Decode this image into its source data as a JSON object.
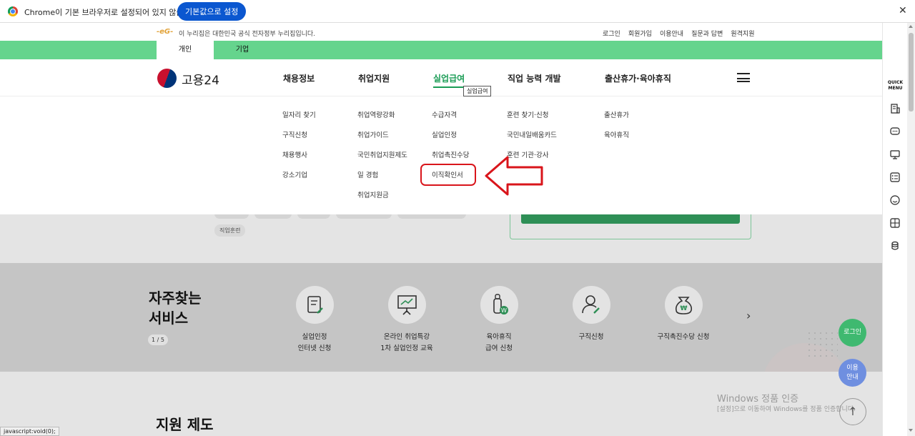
{
  "infobar": {
    "message": "Chrome이 기본 브라우저로 설정되어 있지 않습니다",
    "button_label": "기본값으로 설정",
    "close_glyph": "✕"
  },
  "topbar": {
    "gov_mark": "-eG-",
    "gov_notice": "이 누리집은 대한민국 공식 전자정부 누리집입니다.",
    "links": [
      "로그인",
      "회원가입",
      "이용안내",
      "질문과 답변",
      "원격지원"
    ]
  },
  "tabs": {
    "personal": "개인",
    "company": "기업"
  },
  "logo": {
    "text": "고용24"
  },
  "nav": {
    "items": [
      "채용정보",
      "취업지원",
      "실업급여",
      "직업 능력 개발",
      "출산휴가·육아휴직"
    ],
    "active": "실업급여",
    "tooltip": "실업급여"
  },
  "megamenu": {
    "col1": [
      "일자리 찾기",
      "구직신청",
      "채용행사",
      "강소기업"
    ],
    "col2": [
      "취업역량강화",
      "취업가이드",
      "국민취업지원제도",
      "일 경험",
      "취업지원금"
    ],
    "col3": [
      "수급자격",
      "실업인정",
      "취업촉진수당",
      "이직확인서"
    ],
    "col4": [
      "훈련 찾기·신청",
      "국민내일배움카드",
      "훈련 기관·강사"
    ],
    "col5": [
      "출산휴가",
      "육아휴직"
    ]
  },
  "search": {
    "tag": "직업훈련"
  },
  "services": {
    "title_line1": "자주찾는",
    "title_line2": "서비스",
    "pager": "1 / 5",
    "items": [
      {
        "line1": "실업인정",
        "line2": "인터넷 신청",
        "icon": "document-pen-icon"
      },
      {
        "line1": "온라인 취업특강",
        "line2": "1차 실업인정 교육",
        "icon": "presentation-board-icon"
      },
      {
        "line1": "육아휴직",
        "line2": "급여 신청",
        "icon": "baby-bottle-won-icon"
      },
      {
        "line1": "구직신청",
        "line2": "",
        "icon": "person-pen-icon"
      },
      {
        "line1": "구직촉진수당 신청",
        "line2": "",
        "icon": "money-bag-won-icon"
      }
    ],
    "next_glyph": "›"
  },
  "support": {
    "title": "지원 제도"
  },
  "quickmenu": {
    "title_line1": "QUICK",
    "title_line2": "MENU",
    "icons": [
      "building-icon",
      "chat-icon",
      "monitor-icon",
      "checklist-icon",
      "smile-icon",
      "calculator-icon",
      "coins-icon"
    ]
  },
  "floating": {
    "login": "로그인",
    "guide_line1": "이용",
    "guide_line2": "안내",
    "top_glyph": "↑"
  },
  "watermark": {
    "line1": "Windows 정품 인증",
    "line2": "[설정]으로 이동하여 Windows를 정품 인증합니다."
  },
  "statusbar": "javascript:void(0);",
  "colors": {
    "brand_green": "#65d48d",
    "active_green": "#1a9c55",
    "annotation_red": "#d9151b",
    "chrome_blue": "#0b57d0"
  }
}
